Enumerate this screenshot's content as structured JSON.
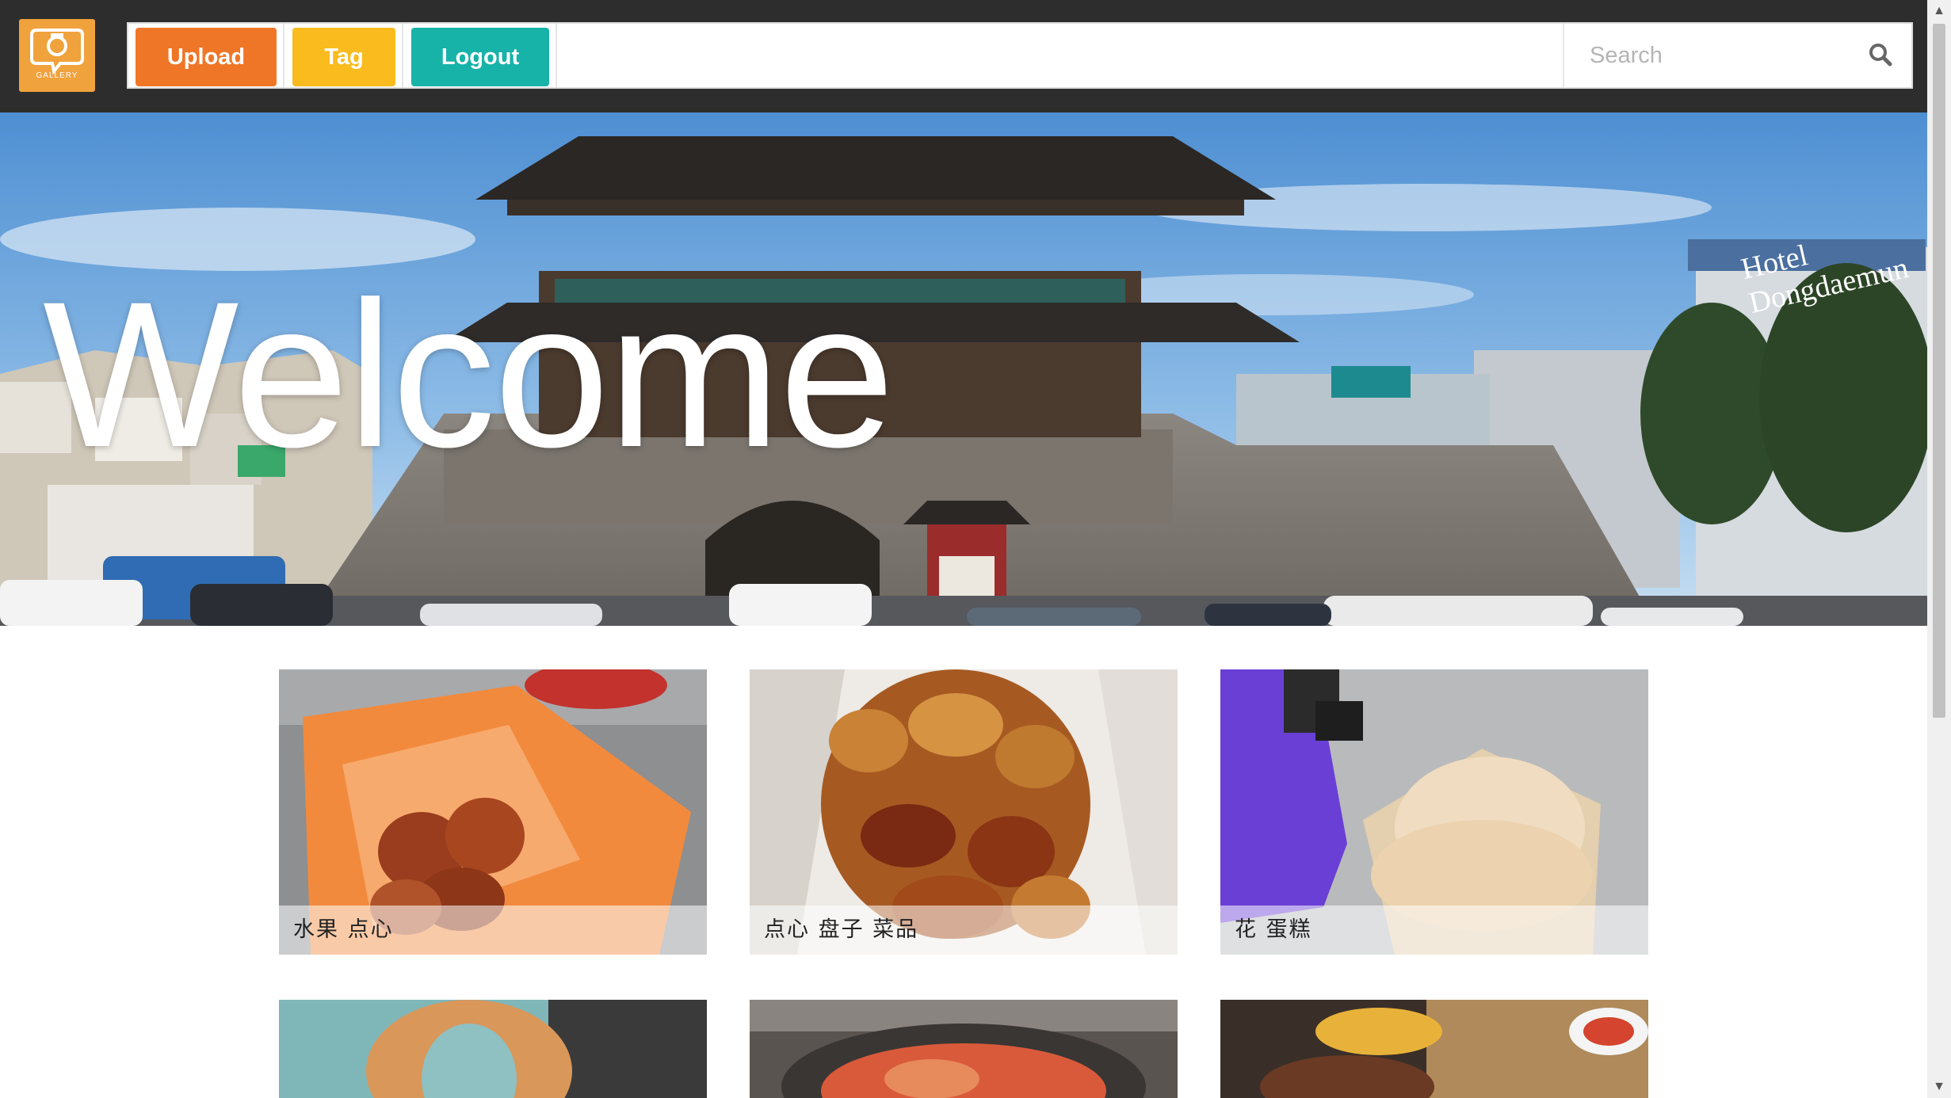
{
  "header": {
    "logo_text": "GALLERY",
    "buttons": {
      "upload": "Upload",
      "tag": "Tag",
      "logout": "Logout"
    },
    "search": {
      "placeholder": "Search",
      "value": ""
    }
  },
  "hero": {
    "title": "Welcome",
    "sign_text": "Hotel Dongdaemun"
  },
  "gallery": {
    "items": [
      {
        "caption": "水果 点心"
      },
      {
        "caption": "点心 盘子 菜品"
      },
      {
        "caption": "花 蛋糕"
      },
      {
        "caption": ""
      },
      {
        "caption": ""
      },
      {
        "caption": ""
      }
    ]
  },
  "colors": {
    "topbar": "#2d2d2d",
    "upload": "#f07627",
    "tag": "#f9bb1d",
    "logout": "#17b2a8",
    "logo": "#f0a23c"
  },
  "icons": {
    "logo": "gallery-logo-icon",
    "search": "search-icon"
  }
}
